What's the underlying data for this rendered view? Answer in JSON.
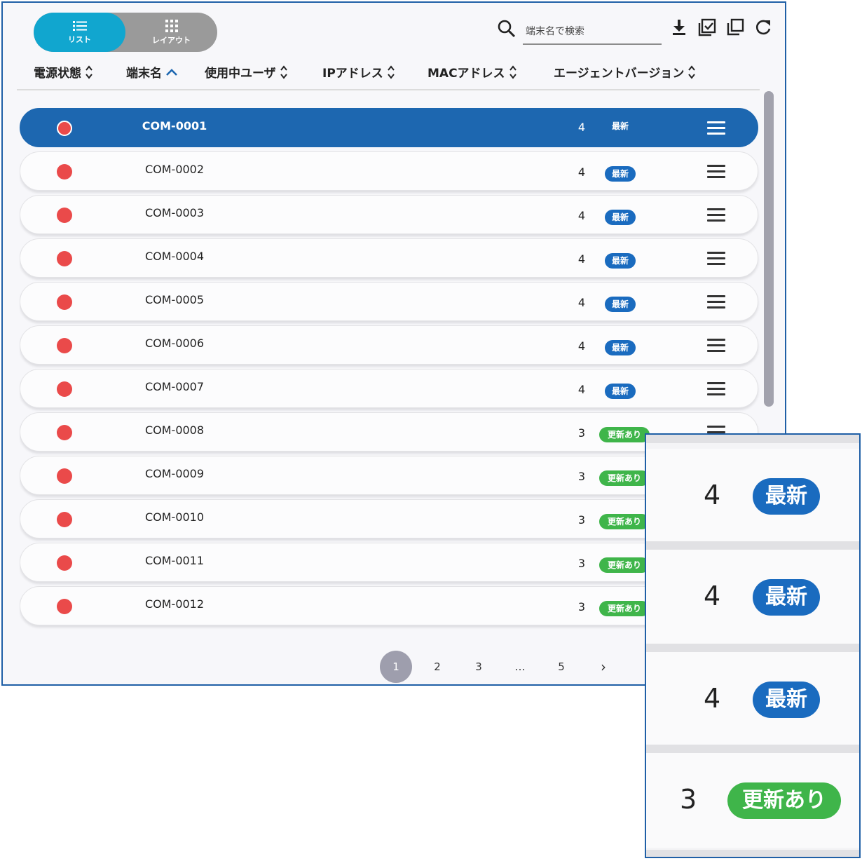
{
  "toggle": {
    "list_label": "リスト",
    "layout_label": "レイアウト"
  },
  "search": {
    "placeholder": "端末名で検索"
  },
  "columns": {
    "power": "電源状態",
    "name": "端末名",
    "user": "使用中ユーザ",
    "ip": "IPアドレス",
    "mac": "MACアドレス",
    "agent": "エージェントバージョン"
  },
  "rows": [
    {
      "name": "COM-0001",
      "version": "4",
      "badge": "最新"
    },
    {
      "name": "COM-0002",
      "version": "4",
      "badge": "最新"
    },
    {
      "name": "COM-0003",
      "version": "4",
      "badge": "最新"
    },
    {
      "name": "COM-0004",
      "version": "4",
      "badge": "最新"
    },
    {
      "name": "COM-0005",
      "version": "4",
      "badge": "最新"
    },
    {
      "name": "COM-0006",
      "version": "4",
      "badge": "最新"
    },
    {
      "name": "COM-0007",
      "version": "4",
      "badge": "最新"
    },
    {
      "name": "COM-0008",
      "version": "3",
      "badge": "更新あり"
    },
    {
      "name": "COM-0009",
      "version": "3",
      "badge": "更新あり"
    },
    {
      "name": "COM-0010",
      "version": "3",
      "badge": "更新あり"
    },
    {
      "name": "COM-0011",
      "version": "3",
      "badge": "更新あり"
    },
    {
      "name": "COM-0012",
      "version": "3",
      "badge": "更新あり"
    }
  ],
  "pagination": {
    "pages": [
      "1",
      "2",
      "3",
      "…",
      "5"
    ],
    "current": "1",
    "next": "›"
  },
  "zoom": [
    {
      "version": "4",
      "badge": "最新"
    },
    {
      "version": "4",
      "badge": "最新"
    },
    {
      "version": "4",
      "badge": "最新"
    },
    {
      "version": "3",
      "badge": "更新あり"
    }
  ],
  "colors": {
    "accent": "#11a6cf",
    "selected_row": "#1d67b0",
    "latest_badge": "#1a6bbf",
    "update_badge": "#3fb54a",
    "power_off": "#ea4a4a"
  },
  "icons": [
    "list-icon",
    "grid-icon",
    "search-icon",
    "download-icon",
    "check-square-icon",
    "copy-icon",
    "refresh-icon",
    "menu-icon",
    "sort-icon",
    "chevron-right-icon"
  ]
}
